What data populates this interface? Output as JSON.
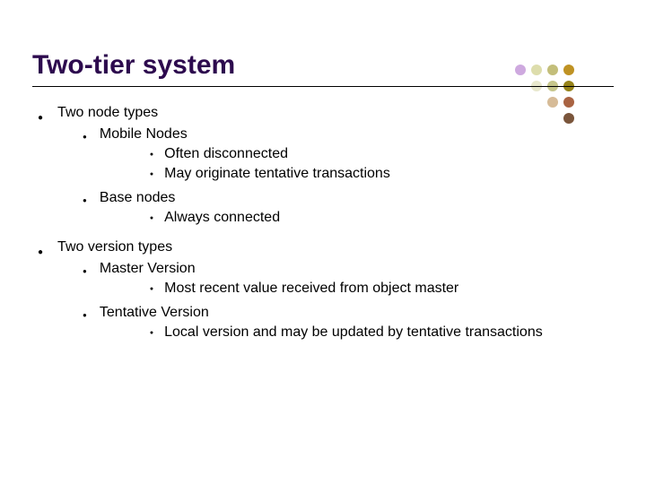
{
  "title": "Two-tier system",
  "bullets": {
    "b1": "Two node types",
    "b1_1": "Mobile Nodes",
    "b1_1_1": "Often disconnected",
    "b1_1_2": "May originate tentative transactions",
    "b1_2": "Base nodes",
    "b1_2_1": "Always connected",
    "b2": "Two version types",
    "b2_1": "Master Version",
    "b2_1_1": "Most recent value received from object master",
    "b2_2": "Tentative Version",
    "b2_2_1": "Local version and may be updated by tentative transactions"
  }
}
